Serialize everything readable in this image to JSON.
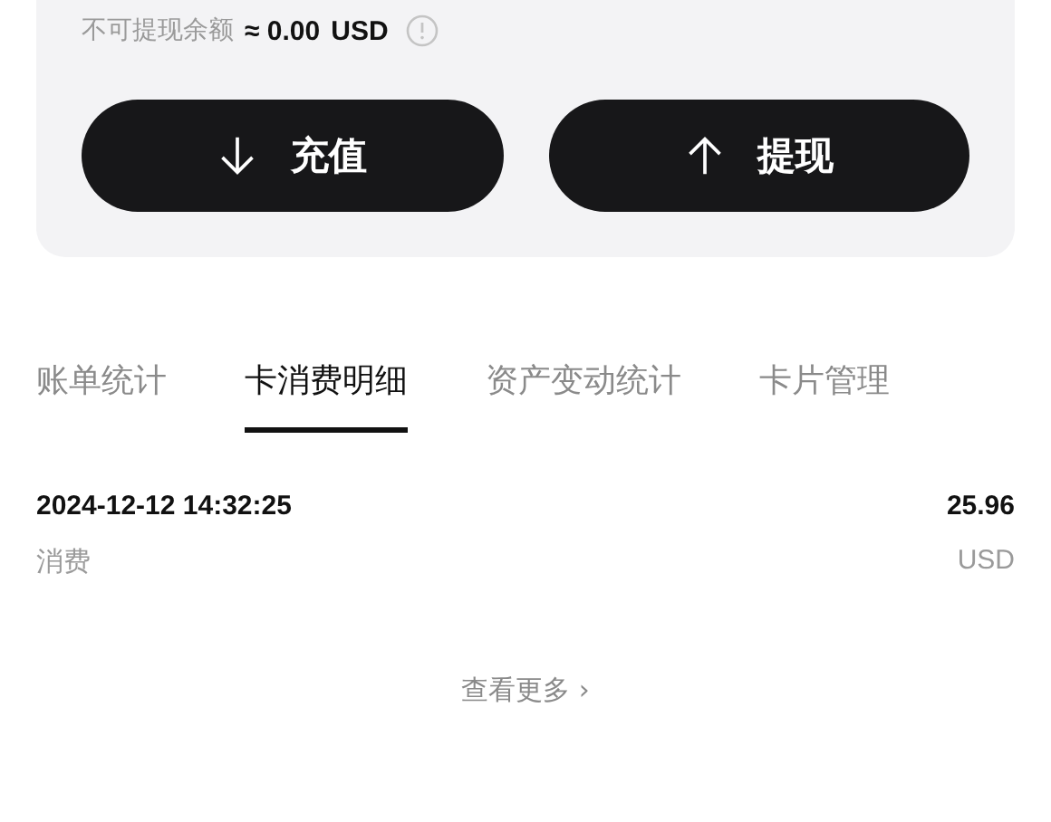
{
  "balance": {
    "label": "不可提现余额",
    "value": "≈ 0.00",
    "currency": "USD"
  },
  "actions": [
    {
      "label": "充值",
      "kind": "down"
    },
    {
      "label": "提现",
      "kind": "up"
    }
  ],
  "tabs": [
    {
      "label": "账单统计",
      "selected": false
    },
    {
      "label": "卡消费明细",
      "selected": true
    },
    {
      "label": "资产变动统计",
      "selected": false
    },
    {
      "label": "卡片管理",
      "selected": false
    }
  ],
  "transactions": [
    {
      "time": "2024-12-12 14:32:25",
      "amount": "25.96",
      "type": "消费",
      "currency": "USD"
    }
  ],
  "more_link": {
    "label": "查看更多",
    "arrow": "›"
  }
}
